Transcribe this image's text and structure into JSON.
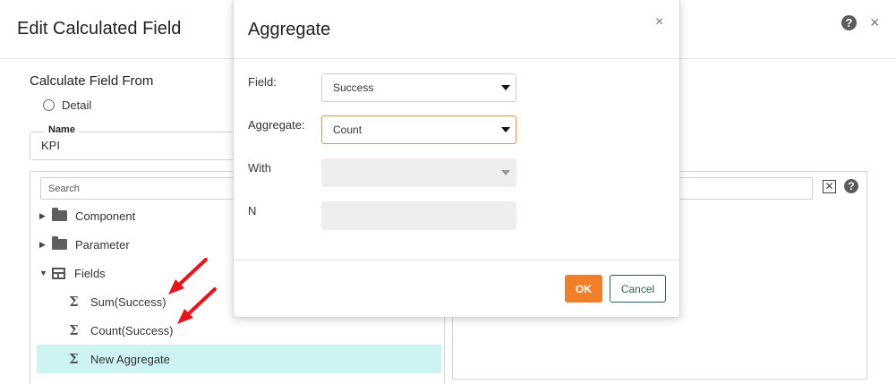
{
  "background_dialog": {
    "title": "Edit Calculated Field",
    "help_glyph": "?",
    "close_glyph": "×",
    "calculate_from_label": "Calculate Field From",
    "detail_option": "Detail",
    "name_label": "Name",
    "name_value": "KPI",
    "tree_search_placeholder": "Search",
    "tree": {
      "items": [
        {
          "label": "Component",
          "icon": "folder-icon",
          "expanded": false
        },
        {
          "label": "Parameter",
          "icon": "folder-icon",
          "expanded": false
        },
        {
          "label": "Fields",
          "icon": "table-icon",
          "expanded": true
        },
        {
          "label": "Sum(Success)",
          "icon": "sigma-icon"
        },
        {
          "label": "Count(Success)",
          "icon": "sigma-icon"
        },
        {
          "label": "New Aggregate",
          "icon": "sigma-icon",
          "selected": true
        }
      ]
    },
    "clear_glyph": "✕"
  },
  "modal": {
    "title": "Aggregate",
    "close_glyph": "×",
    "fields": [
      {
        "label": "Field:",
        "value": "Success",
        "disabled": false
      },
      {
        "label": "Aggregate:",
        "value": "Count",
        "disabled": false,
        "focused": true
      },
      {
        "label": "With",
        "value": "",
        "disabled": true
      },
      {
        "label": "N",
        "value": "",
        "disabled": true
      }
    ],
    "ok_label": "OK",
    "cancel_label": "Cancel"
  },
  "colors": {
    "accent_orange": "#ef7f29",
    "selection_cyan": "#cdf3f3",
    "arrow_red": "#e8141b",
    "cancel_teal": "#2f5d5d"
  }
}
